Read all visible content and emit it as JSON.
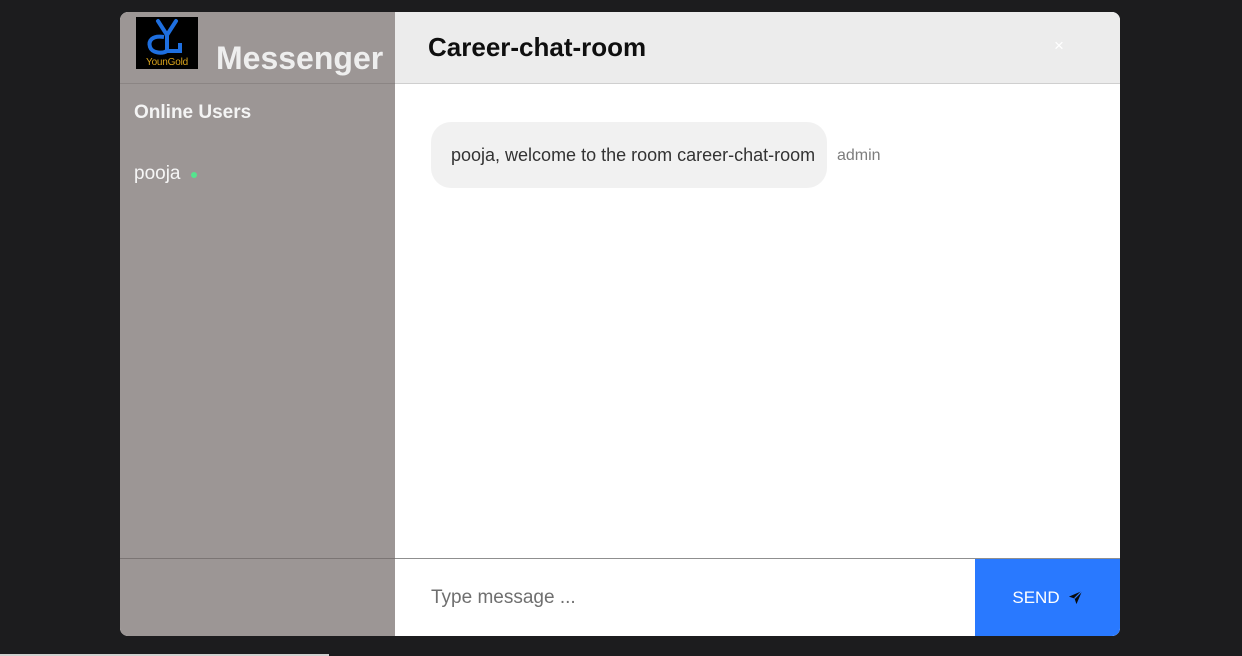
{
  "brand": {
    "logo_text": "YounGold",
    "name": "Messenger"
  },
  "sidebar": {
    "online_title": "Online Users",
    "users": [
      {
        "name": "pooja",
        "status": "online"
      }
    ]
  },
  "chat": {
    "room_title": "Career-chat-room",
    "close_label": "×",
    "messages": [
      {
        "text": "pooja, welcome to the room career-chat-room",
        "author": "admin"
      }
    ]
  },
  "composer": {
    "placeholder": "Type message ...",
    "send_label": "SEND",
    "send_icon": "paper-plane-icon"
  },
  "colors": {
    "page_bg": "#1c1c1e",
    "sidebar_bg": "#9c9695",
    "header_bg": "#ececec",
    "bubble_bg": "#f1f1f1",
    "online_dot": "#55e58e",
    "send_bg": "#2979ff",
    "logo_accent": "#d9a21b",
    "logo_blue": "#1e6fe0"
  }
}
